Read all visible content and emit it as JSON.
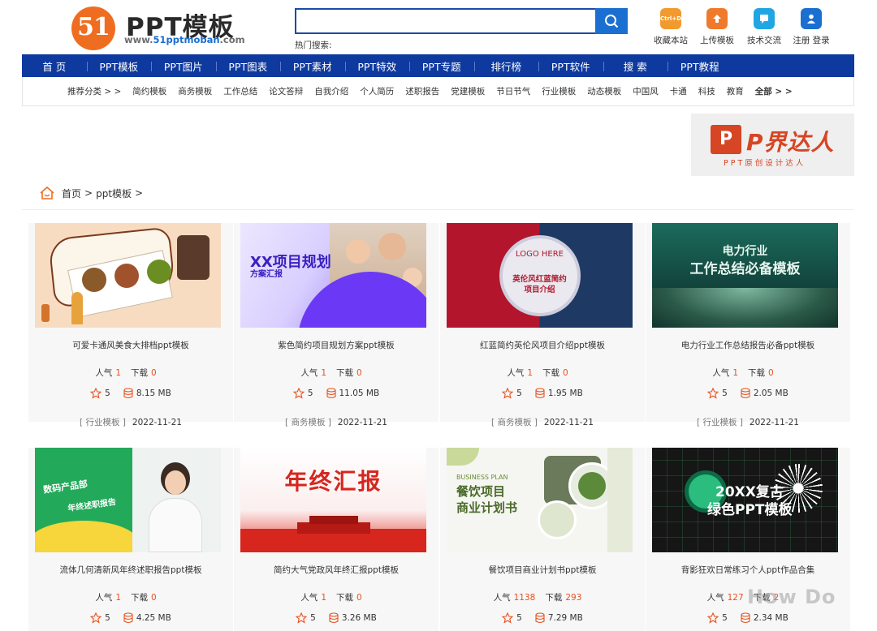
{
  "header": {
    "logo_mark": "51",
    "logo_title": "PPT模板",
    "logo_url_prefix": "www.",
    "logo_url_highlight": "51pptmoban",
    "logo_url_suffix": ".com",
    "search_placeholder": "",
    "hot_search_label": "热门搜索:",
    "top_links": [
      {
        "label": "收藏本站",
        "icon": "bookmark-icon",
        "icon_text": "Ctrl+D",
        "color": "#f29a2e"
      },
      {
        "label": "上传模板",
        "icon": "upload-icon",
        "color": "#f07a2b"
      },
      {
        "label": "技术交流",
        "icon": "chat-icon",
        "color": "#21a6e3"
      },
      {
        "label": "注册 登录",
        "icon": "user-icon",
        "color": "#1a6fd1"
      }
    ]
  },
  "main_nav": [
    "首 页",
    "PPT模板",
    "PPT图片",
    "PPT图表",
    "PPT素材",
    "PPT特效",
    "PPT专题",
    "排行榜",
    "PPT软件",
    "搜 索",
    "PPT教程"
  ],
  "sub_nav": {
    "prefix": "推荐分类 > >",
    "items": [
      "简约模板",
      "商务模板",
      "工作总结",
      "论文答辩",
      "自我介绍",
      "个人简历",
      "述职报告",
      "党建模板",
      "节日节气",
      "行业模板",
      "动态模板",
      "中国风",
      "卡通",
      "科技",
      "教育"
    ],
    "all_label": "全部 > >"
  },
  "banner": {
    "icon_text": "P",
    "title": "P界达人",
    "subtitle": "PPT原创设计达人"
  },
  "breadcrumb": {
    "home": "首页",
    "sep": ">",
    "current": "ppt模板",
    "trail": ">"
  },
  "labels": {
    "popularity": "人气",
    "downloads": "下载"
  },
  "cards": [
    {
      "title": "可爱卡通风美食大排档ppt模板",
      "popularity": "1",
      "downloads": "0",
      "rating": "5",
      "size": "8.15 MB",
      "category": "[ 行业模板 ]",
      "date": "2022-11-21"
    },
    {
      "title": "紫色简约项目规划方案ppt模板",
      "popularity": "1",
      "downloads": "0",
      "rating": "5",
      "size": "11.05 MB",
      "category": "[ 商务模板 ]",
      "date": "2022-11-21",
      "thumb_title": "XX项目规划",
      "thumb_sub": "方案汇报"
    },
    {
      "title": "红蓝简约英伦风项目介绍ppt模板",
      "popularity": "1",
      "downloads": "0",
      "rating": "5",
      "size": "1.95 MB",
      "category": "[ 商务模板 ]",
      "date": "2022-11-21",
      "thumb_logo": "LOGO HERE",
      "thumb_title": "英伦风红蓝简约\n项目介绍"
    },
    {
      "title": "电力行业工作总结报告必备ppt模板",
      "popularity": "1",
      "downloads": "0",
      "rating": "5",
      "size": "2.05 MB",
      "category": "[ 行业模板 ]",
      "date": "2022-11-21",
      "thumb_title1": "电力行业",
      "thumb_title2": "工作总结必备模板"
    },
    {
      "title": "流体几何清新风年终述职报告ppt模板",
      "popularity": "1",
      "downloads": "0",
      "rating": "5",
      "size": "4.25 MB",
      "thumb_title1": "数码产品部",
      "thumb_title2": "年终述职报告"
    },
    {
      "title": "简约大气党政风年终汇报ppt模板",
      "popularity": "1",
      "downloads": "0",
      "rating": "5",
      "size": "3.26 MB",
      "thumb_title": "年终汇报"
    },
    {
      "title": "餐饮项目商业计划书ppt模板",
      "popularity": "1138",
      "downloads": "293",
      "rating": "5",
      "size": "7.29 MB",
      "thumb_en": "BUSINESS PLAN",
      "thumb_title1": "餐饮项目",
      "thumb_title2": "商业计划书"
    },
    {
      "title": "背影狂欢日常练习个人ppt作品合集",
      "popularity": "127",
      "downloads": "2",
      "rating": "5",
      "size": "2.34 MB",
      "thumb_title1": "20XX复古",
      "thumb_title2": "绿色PPT模板"
    }
  ],
  "watermark": "How Do"
}
